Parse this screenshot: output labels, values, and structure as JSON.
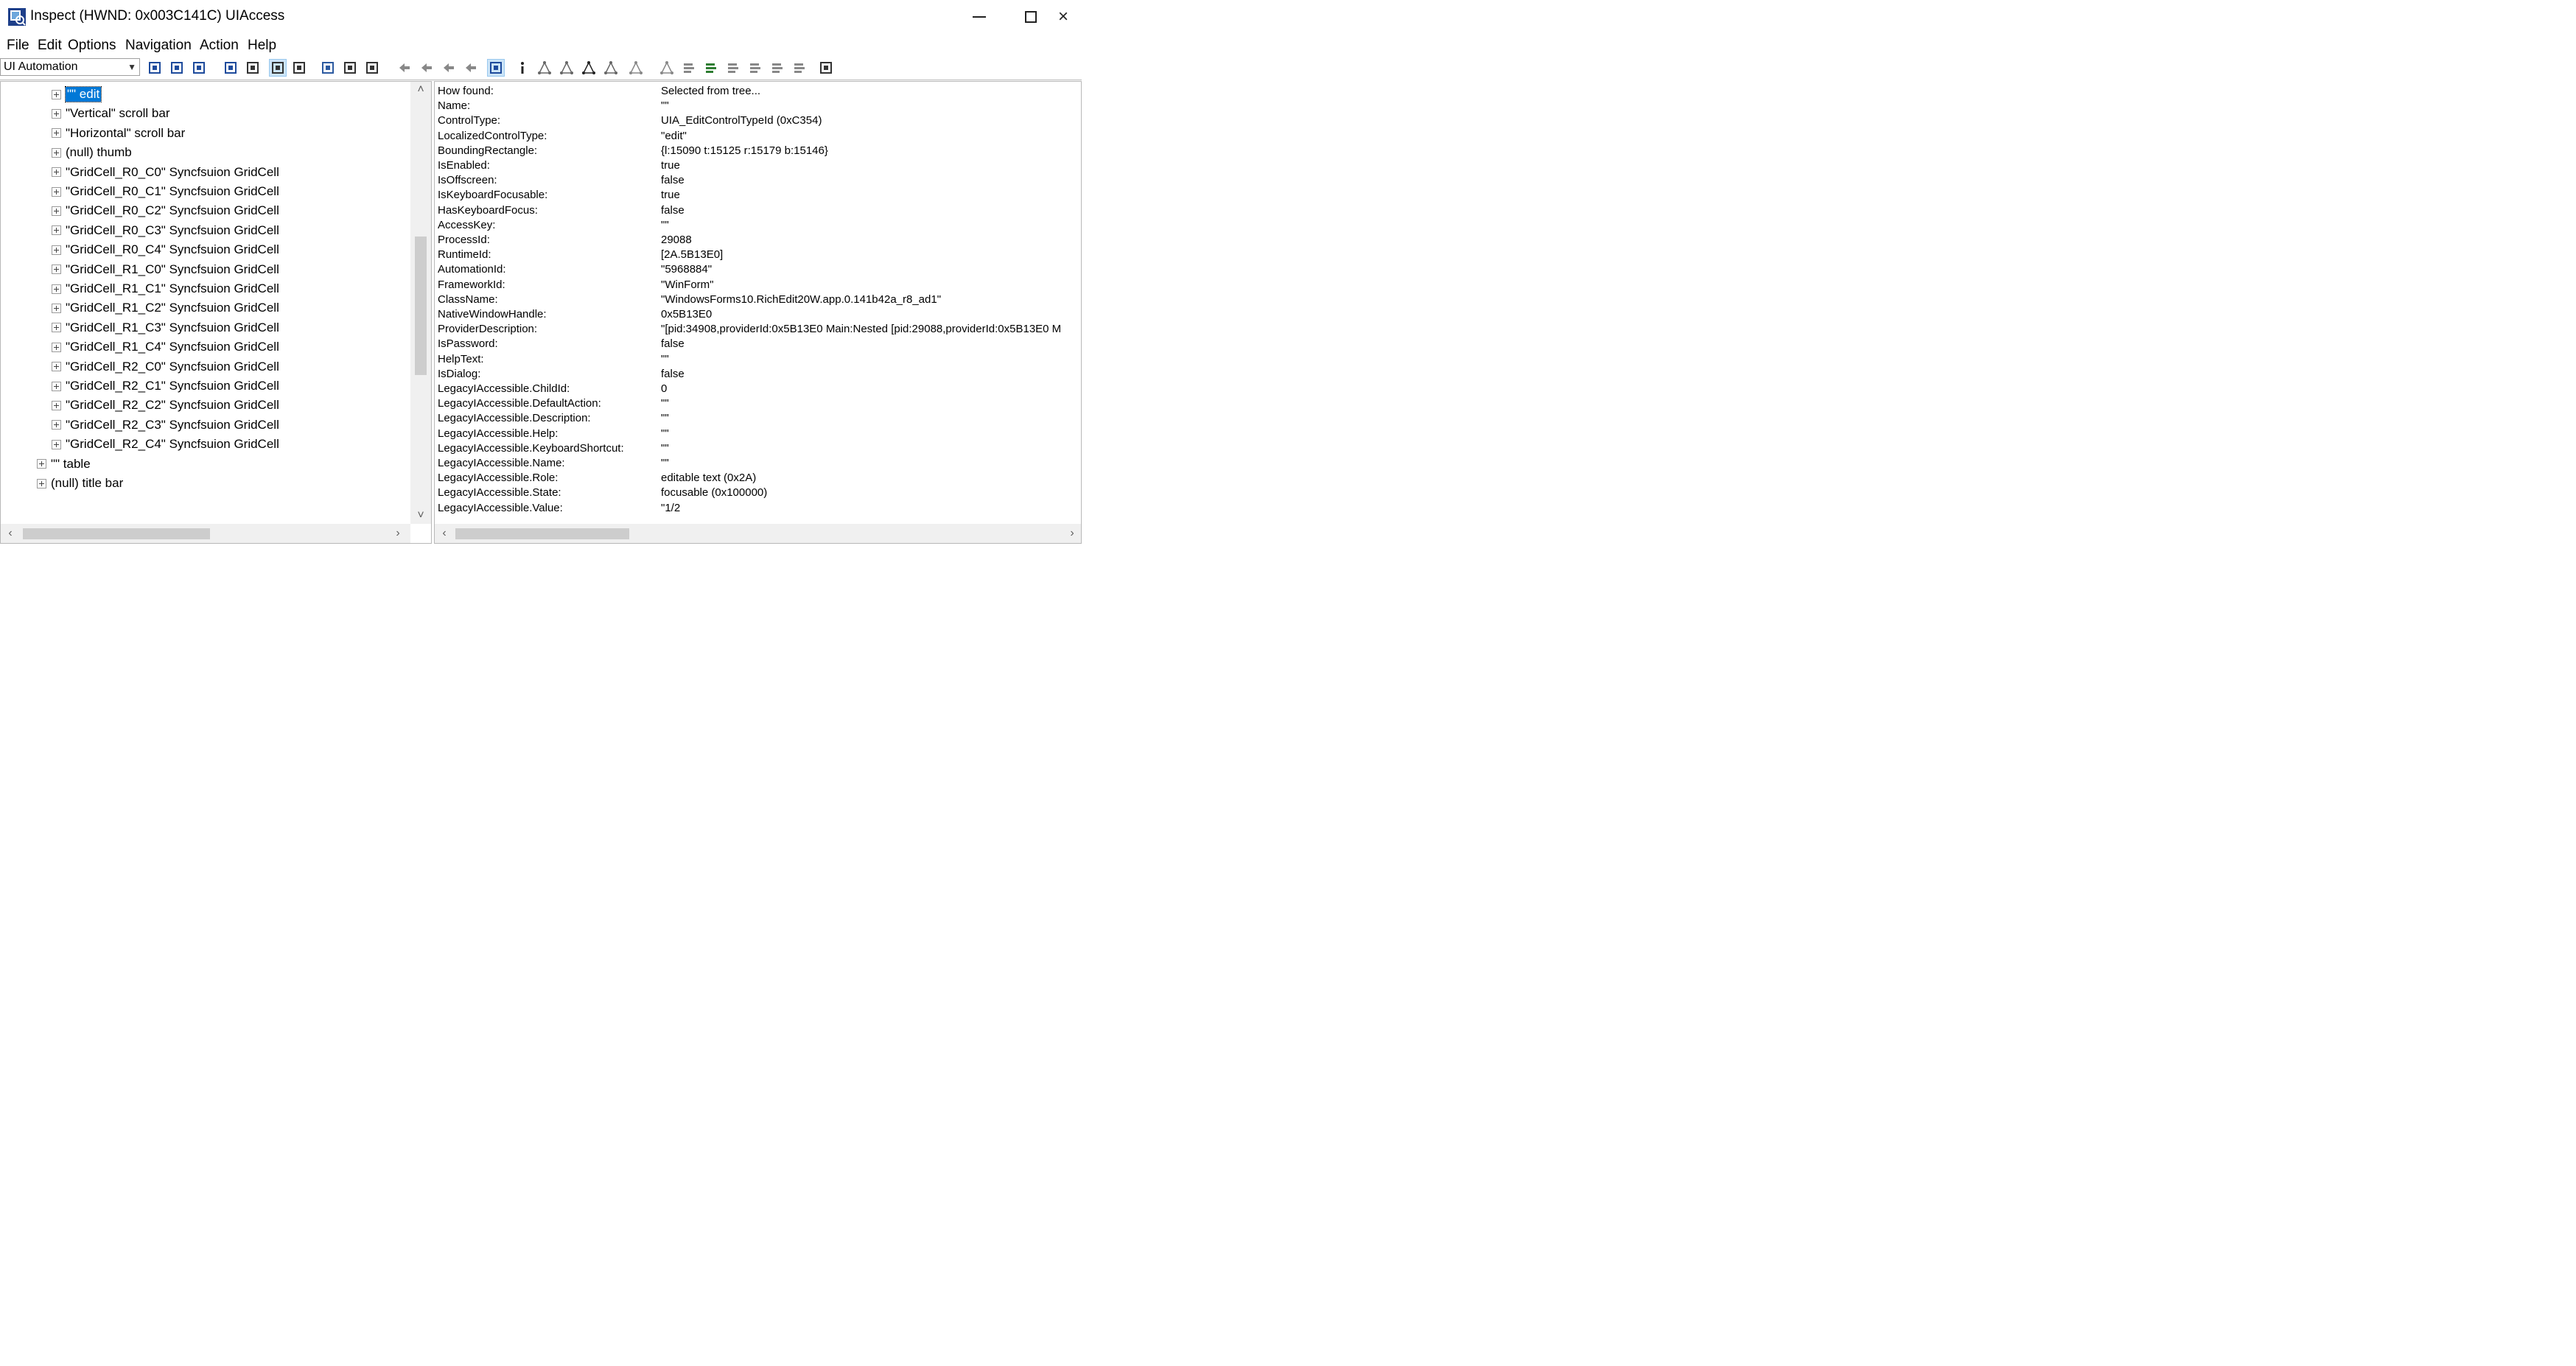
{
  "window": {
    "title": "Inspect  (HWND: 0x003C141C) UIAccess",
    "min_glyph": "",
    "close_glyph": "×"
  },
  "menu": [
    "File",
    "Edit",
    "Options",
    "Navigation",
    "Action",
    "Help"
  ],
  "toolbar": {
    "mode_select": "UI Automation",
    "icons": [
      "refresh-icon",
      "copy-icon",
      "screenshot-icon",
      "highlight-rect-icon",
      "text-cursor-icon",
      "pointer-icon",
      "filter-icon",
      "focus-icon",
      "hourglass-icon",
      "caret-icon",
      "nav-parent-icon",
      "nav-prev-icon",
      "nav-next-icon",
      "nav-last-icon",
      "tree-mode-icon",
      "info-icon",
      "tree-a-icon",
      "tree-b-icon",
      "tree-c-icon",
      "tree-d-icon",
      "tree-e-icon",
      "tree-f-icon",
      "action-a-icon",
      "action-b-icon",
      "action-c-icon",
      "action-d-icon",
      "action-e-icon",
      "action-f-icon",
      "sync-icon"
    ]
  },
  "tree": [
    {
      "label": "\"\" edit",
      "indent": 2,
      "selected": true
    },
    {
      "label": "\"Vertical\" scroll bar",
      "indent": 2
    },
    {
      "label": "\"Horizontal\" scroll bar",
      "indent": 2
    },
    {
      "label": "(null) thumb",
      "indent": 2
    },
    {
      "label": "\"GridCell_R0_C0\" Syncfsuion GridCell",
      "indent": 2
    },
    {
      "label": "\"GridCell_R0_C1\" Syncfsuion GridCell",
      "indent": 2
    },
    {
      "label": "\"GridCell_R0_C2\" Syncfsuion GridCell",
      "indent": 2
    },
    {
      "label": "\"GridCell_R0_C3\" Syncfsuion GridCell",
      "indent": 2
    },
    {
      "label": "\"GridCell_R0_C4\" Syncfsuion GridCell",
      "indent": 2
    },
    {
      "label": "\"GridCell_R1_C0\" Syncfsuion GridCell",
      "indent": 2
    },
    {
      "label": "\"GridCell_R1_C1\" Syncfsuion GridCell",
      "indent": 2
    },
    {
      "label": "\"GridCell_R1_C2\" Syncfsuion GridCell",
      "indent": 2
    },
    {
      "label": "\"GridCell_R1_C3\" Syncfsuion GridCell",
      "indent": 2
    },
    {
      "label": "\"GridCell_R1_C4\" Syncfsuion GridCell",
      "indent": 2
    },
    {
      "label": "\"GridCell_R2_C0\" Syncfsuion GridCell",
      "indent": 2
    },
    {
      "label": "\"GridCell_R2_C1\" Syncfsuion GridCell",
      "indent": 2
    },
    {
      "label": "\"GridCell_R2_C2\" Syncfsuion GridCell",
      "indent": 2
    },
    {
      "label": "\"GridCell_R2_C3\" Syncfsuion GridCell",
      "indent": 2
    },
    {
      "label": "\"GridCell_R2_C4\" Syncfsuion GridCell",
      "indent": 2
    },
    {
      "label": "\"\" table",
      "indent": 1
    },
    {
      "label": "(null) title bar",
      "indent": 1
    }
  ],
  "properties": [
    {
      "name": "How found:",
      "value": "Selected from tree..."
    },
    {
      "name": "Name:",
      "value": "\"\""
    },
    {
      "name": "ControlType:",
      "value": "UIA_EditControlTypeId (0xC354)"
    },
    {
      "name": "LocalizedControlType:",
      "value": "\"edit\""
    },
    {
      "name": "BoundingRectangle:",
      "value": "{l:15090 t:15125 r:15179 b:15146}"
    },
    {
      "name": "IsEnabled:",
      "value": "true"
    },
    {
      "name": "IsOffscreen:",
      "value": "false"
    },
    {
      "name": "IsKeyboardFocusable:",
      "value": "true"
    },
    {
      "name": "HasKeyboardFocus:",
      "value": "false"
    },
    {
      "name": "AccessKey:",
      "value": "\"\""
    },
    {
      "name": "ProcessId:",
      "value": "29088"
    },
    {
      "name": "RuntimeId:",
      "value": "[2A.5B13E0]"
    },
    {
      "name": "AutomationId:",
      "value": "\"5968884\""
    },
    {
      "name": "FrameworkId:",
      "value": "\"WinForm\""
    },
    {
      "name": "ClassName:",
      "value": "\"WindowsForms10.RichEdit20W.app.0.141b42a_r8_ad1\""
    },
    {
      "name": "NativeWindowHandle:",
      "value": "0x5B13E0"
    },
    {
      "name": "ProviderDescription:",
      "value": "\"[pid:34908,providerId:0x5B13E0 Main:Nested [pid:29088,providerId:0x5B13E0 M"
    },
    {
      "name": "IsPassword:",
      "value": "false"
    },
    {
      "name": "HelpText:",
      "value": "\"\""
    },
    {
      "name": "IsDialog:",
      "value": "false"
    },
    {
      "name": "LegacyIAccessible.ChildId:",
      "value": "0"
    },
    {
      "name": "LegacyIAccessible.DefaultAction:",
      "value": "\"\""
    },
    {
      "name": "LegacyIAccessible.Description:",
      "value": "\"\""
    },
    {
      "name": "LegacyIAccessible.Help:",
      "value": "\"\""
    },
    {
      "name": "LegacyIAccessible.KeyboardShortcut:",
      "value": "\"\""
    },
    {
      "name": "LegacyIAccessible.Name:",
      "value": "\"\""
    },
    {
      "name": "LegacyIAccessible.Role:",
      "value": "editable text (0x2A)"
    },
    {
      "name": "LegacyIAccessible.State:",
      "value": "focusable (0x100000)"
    },
    {
      "name": "LegacyIAccessible.Value:",
      "value": "\"1/2"
    }
  ]
}
